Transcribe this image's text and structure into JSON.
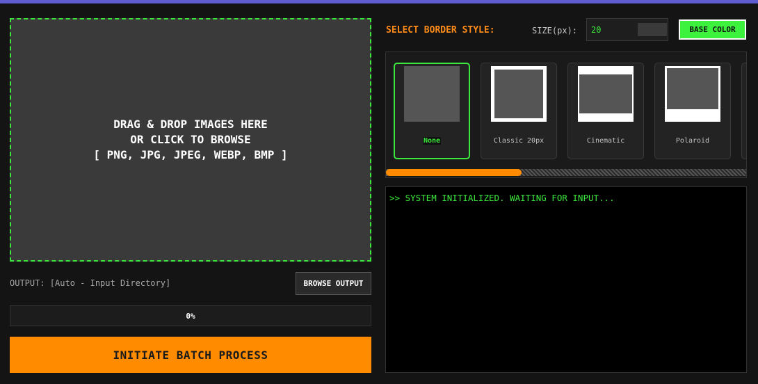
{
  "dropzone": {
    "line1": "DRAG & DROP IMAGES HERE",
    "line2": "OR CLICK TO BROWSE",
    "line3": "[ PNG, JPG, JPEG, WEBP, BMP ]"
  },
  "output": {
    "label": "OUTPUT: [Auto - Input Directory]",
    "browse_label": "BROWSE OUTPUT"
  },
  "progress": {
    "text": "0%",
    "value": 0
  },
  "process_button": "INITIATE BATCH PROCESS",
  "border": {
    "title": "SELECT BORDER STYLE:",
    "size_label": "SIZE(px):",
    "size_value": "20",
    "base_color_label": "BASE COLOR",
    "styles": [
      {
        "label": "None",
        "selected": true
      },
      {
        "label": "Classic 20px",
        "selected": false
      },
      {
        "label": "Cinematic",
        "selected": false
      },
      {
        "label": "Polaroid",
        "selected": false
      }
    ]
  },
  "console": {
    "lines": [
      ">> SYSTEM INITIALIZED. WAITING FOR INPUT..."
    ]
  },
  "colors": {
    "accent_green": "#3ce83c",
    "accent_orange": "#ff8c00",
    "top_bar": "#5f5bd0",
    "base_color": "#3df23d"
  }
}
